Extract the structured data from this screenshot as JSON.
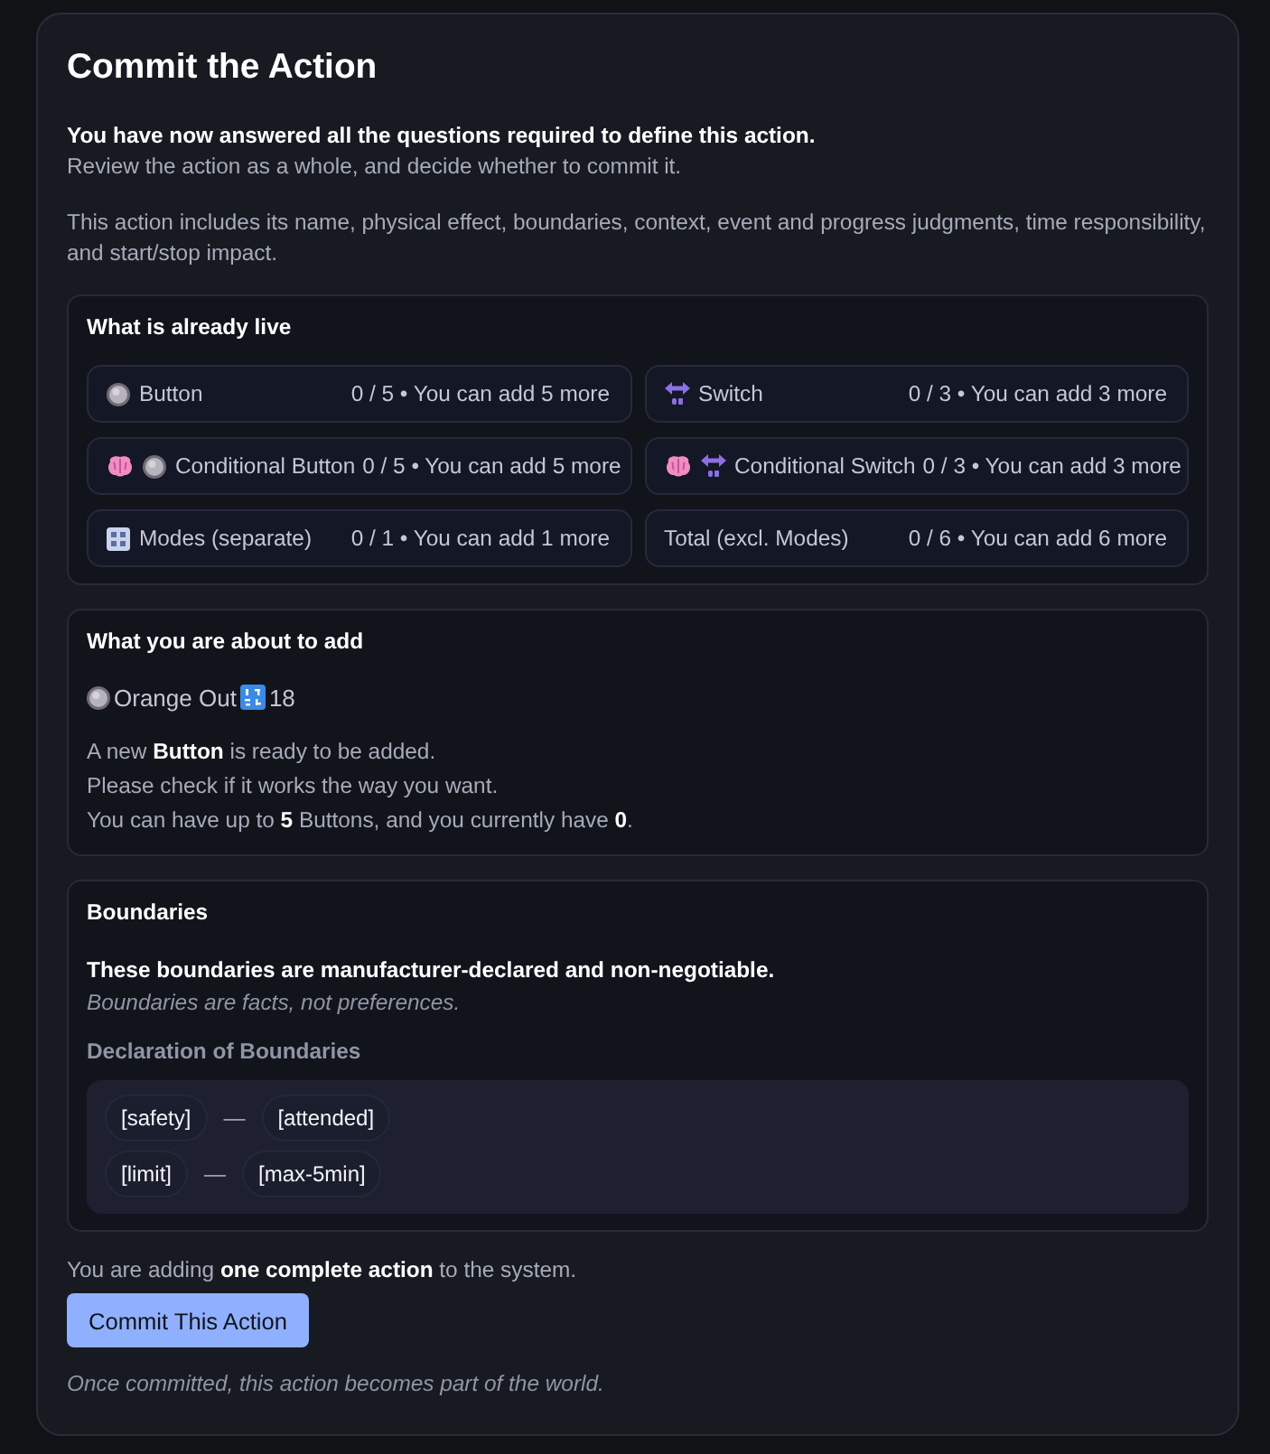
{
  "title": "Commit the Action",
  "intro": {
    "lead": "You have now answered all the questions required to define this action.",
    "sub": "Review the action as a whole, and decide whether to commit it."
  },
  "summary": "This action includes its name, physical effect, boundaries, context, event and progress judgments, time responsibility, and start/stop impact.",
  "live": {
    "heading": "What is already live",
    "items": [
      {
        "kind": "button",
        "label": "Button",
        "count": "0 / 5 • You can add 5 more"
      },
      {
        "kind": "switch",
        "label": "Switch",
        "count": "0 / 3 • You can add 3 more"
      },
      {
        "kind": "conditional_button",
        "label": "Conditional Button",
        "count": "0 / 5 • You can add 5 more"
      },
      {
        "kind": "conditional_switch",
        "label": "Conditional Switch",
        "count": "0 / 3 • You can add 3 more"
      },
      {
        "kind": "modes",
        "label": "Modes (separate)",
        "count": "0 / 1 • You can add 1 more"
      },
      {
        "kind": "total",
        "label": "Total (excl. Modes)",
        "count": "0 / 6 • You can add 6 more"
      }
    ]
  },
  "adding": {
    "heading": "What you are about to add",
    "item": {
      "kind": "button",
      "name": "Orange Out",
      "number": "18"
    },
    "lines": [
      "A new **Button** is ready to be added.",
      "Please check if it works the way you want.",
      "You can have up to **5** Buttons, and you currently have **0**."
    ]
  },
  "boundaries": {
    "heading": "Boundaries",
    "statement": "These boundaries are manufacturer-declared and non-negotiable.",
    "note": "Boundaries are facts, not preferences.",
    "declaration_heading": "Declaration of Boundaries",
    "rows": [
      {
        "key": "[safety]",
        "separator": "—",
        "value": "[attended]"
      },
      {
        "key": "[limit]",
        "separator": "—",
        "value": "[max-5min]"
      }
    ]
  },
  "footer": {
    "notice": "You are adding **one complete action** to the system.",
    "button": "Commit This Action",
    "caption": "Once committed, this action becomes part of the world."
  }
}
